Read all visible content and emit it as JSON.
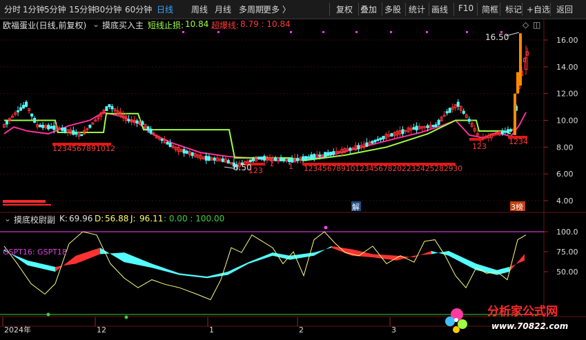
{
  "toolbar": {
    "periods": [
      "分时",
      "1分钟",
      "5分钟",
      "15分钟",
      "30分钟",
      "60分钟",
      "日线",
      "周线",
      "月线",
      "多周期",
      "更多 〉"
    ],
    "active_period": "日线",
    "actions": [
      "复权",
      "叠加",
      "多股",
      "统计",
      "画线",
      "F10",
      "简框",
      "标记",
      "+自选",
      "返回"
    ]
  },
  "main_header": {
    "stock": "欧福蛋业(日线,前复权)",
    "indicator": "摸底买入主",
    "stop_label": "短线止损:",
    "stop_value": "10.84",
    "overbuy_label": "超爆线:",
    "overbuy_values": "8.79 : 10.84"
  },
  "sub_header": {
    "indicator": "摸底校尉副",
    "k_label": "K:",
    "k_value": "69.96",
    "d_label": "D:",
    "d_value": "56.88",
    "j_label": "J:",
    "j_value": "96.11",
    "extra": ": 0.00 : 100.00",
    "legend_text": "GSPT16:  GSPT18"
  },
  "price_axis": [
    "16.00",
    "14.00",
    "12.00",
    "10.00",
    "8.00",
    "6.00",
    "4.00"
  ],
  "osc_axis": [
    "100.0",
    "75.00",
    "50.00"
  ],
  "time_axis": [
    "2024年",
    "12",
    "1",
    "2",
    "3"
  ],
  "annotations": {
    "high_label": "16.50",
    "low_label": "6.50",
    "count_seq_1": "1234567891012",
    "count_seq_2": "123",
    "count_seq_3": "1",
    "count_seq_4": "1",
    "count_seq_5": "1234567891012345678202232425282930",
    "count_seq_6": "123",
    "count_seq_7": "1234",
    "badge_jie": "解",
    "badge_bang": "3榜"
  },
  "watermark": {
    "title": "分析家公式网",
    "url": "www.70822.com"
  },
  "colors": {
    "active": "#3aa0ff",
    "up": "#ff3232",
    "down": "#54ffff",
    "stopline": "#a0ff40",
    "ma": "#ff2fa0",
    "kline": "#ffff80",
    "highline": "#ff40ff",
    "lowline": "#40d040"
  }
}
